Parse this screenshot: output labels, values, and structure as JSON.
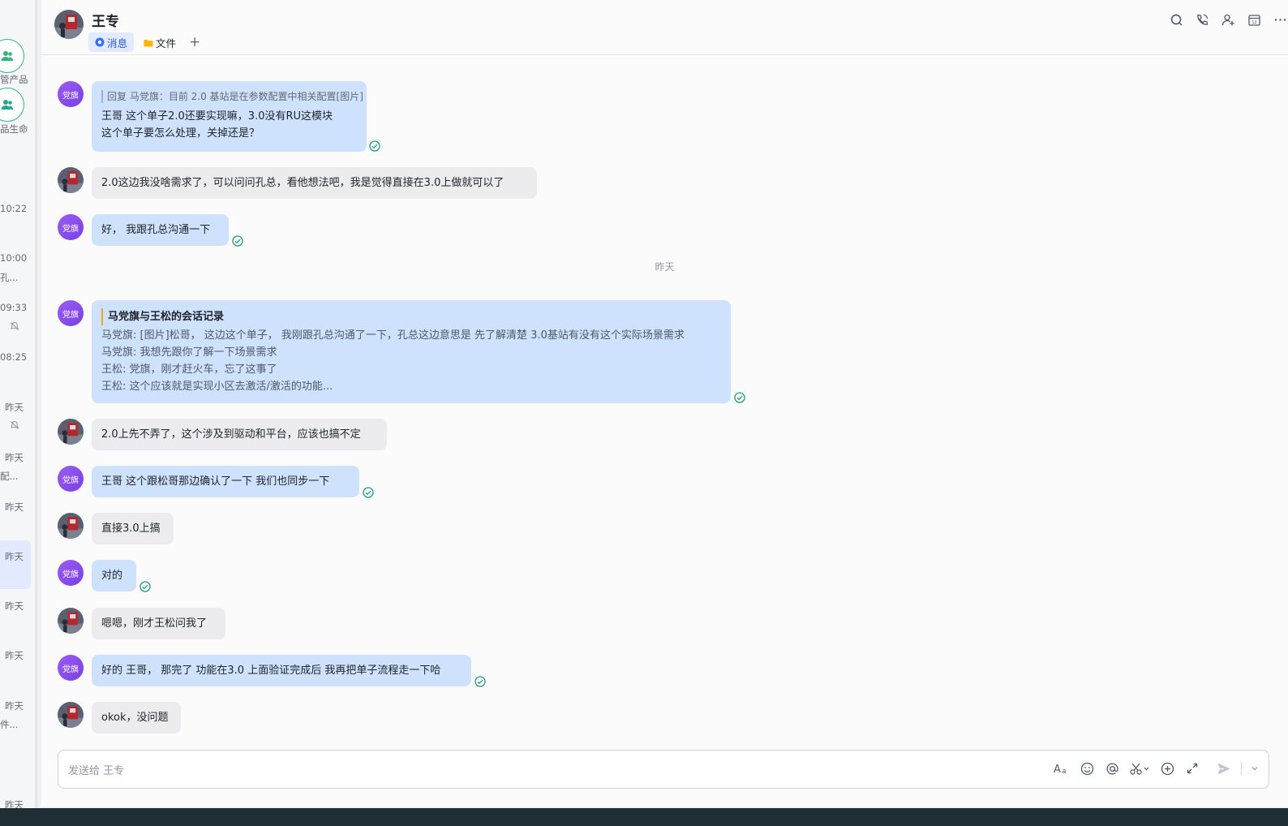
{
  "left_list": {
    "items": [
      {
        "text": "管产品"
      },
      {
        "text": "品生命"
      },
      {
        "text": "10:22"
      },
      {
        "text": "10:00"
      },
      {
        "text": "孔..."
      },
      {
        "text": "09:33"
      },
      {
        "text": "08:25"
      },
      {
        "text": "昨天"
      },
      {
        "text": "昨天"
      },
      {
        "text": "配..."
      },
      {
        "text": "昨天"
      },
      {
        "text": "昨天"
      },
      {
        "text": "昨天"
      },
      {
        "text": "昨天"
      },
      {
        "text": "昨天"
      },
      {
        "text": "件..."
      },
      {
        "text": "昨天"
      }
    ]
  },
  "header": {
    "name": "王专",
    "tabs": {
      "messages": "消息",
      "files": "文件",
      "add": "+"
    },
    "icons": [
      "search-chat-icon",
      "call-icon",
      "add-member-icon",
      "calendar-icon",
      "more-icon"
    ]
  },
  "chat": {
    "date_separator": "昨天",
    "self_avatar_label": "党旗",
    "messages": [
      {
        "from": "self",
        "reply": "回复 马党旗：目前 2.0 基站是在参数配置中相关配置[图片]",
        "lines": [
          "王哥 这个单子2.0还要实现嘛，3.0没有RU这模块",
          "这个单子要怎么处理，关掉还是？"
        ],
        "read": true
      },
      {
        "from": "other",
        "lines": [
          "2.0这边我没啥需求了，可以问问孔总，看他想法吧，我是觉得直接在3.0上做就可以了"
        ]
      },
      {
        "from": "self",
        "lines": [
          "好， 我跟孔总沟通一下"
        ],
        "read": true
      },
      {
        "from": "self",
        "card_title": "马党旗与王松的会话记录",
        "lines": [
          "马党旗: [图片]松哥， 这边这个单子， 我刚跟孔总沟通了一下，孔总这边意思是 先了解清楚 3.0基站有没有这个实际场景需求",
          "马党旗: 我想先跟你了解一下场景需求",
          "王松: 党旗，刚才赶火车，忘了这事了",
          "王松: 这个应该就是实现小区去激活/激活的功能..."
        ],
        "read": true
      },
      {
        "from": "other",
        "lines": [
          "2.0上先不弄了，这个涉及到驱动和平台，应该也搞不定"
        ]
      },
      {
        "from": "self",
        "lines": [
          "王哥  这个跟松哥那边确认了一下 我们也同步一下"
        ],
        "read": true
      },
      {
        "from": "other",
        "lines": [
          "直接3.0上搞"
        ]
      },
      {
        "from": "self",
        "lines": [
          "对的"
        ],
        "read": true
      },
      {
        "from": "other",
        "lines": [
          "嗯嗯，刚才王松问我了"
        ]
      },
      {
        "from": "self",
        "lines": [
          "好的 王哥， 那完了 功能在3.0 上面验证完成后 我再把单子流程走一下哈"
        ],
        "read": true
      },
      {
        "from": "other",
        "lines": [
          "okok，没问题"
        ]
      }
    ]
  },
  "input": {
    "placeholder": "发送给 王专",
    "tools": [
      "text-format-icon",
      "emoji-icon",
      "mention-icon",
      "screenshot-icon",
      "plus-circle-icon",
      "expand-icon",
      "send-icon"
    ]
  },
  "colors": {
    "self_bubble": "#cfe2fd",
    "other_bubble": "#ececee",
    "accent": "#245bdb",
    "read_check": "#1f9b76"
  }
}
